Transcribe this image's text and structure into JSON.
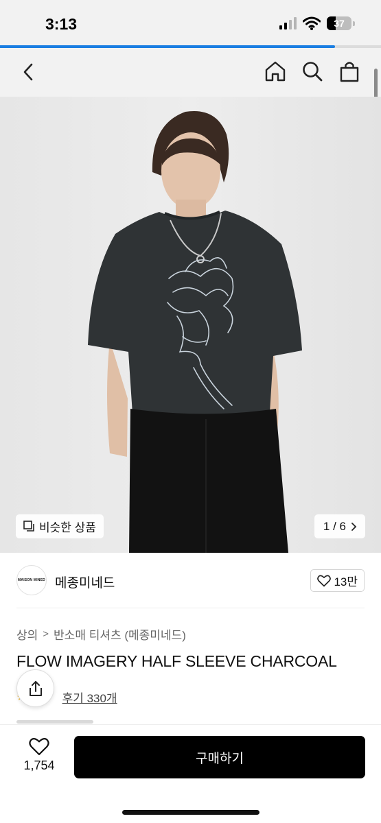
{
  "status_bar": {
    "time": "3:13",
    "battery_level": "37",
    "icons": [
      "signal-icon",
      "wifi-icon",
      "battery-icon"
    ]
  },
  "page_load": {
    "progress": 0.88,
    "color": "#1a7ee2"
  },
  "nav": {
    "back_icon": "chevron-left-icon",
    "right_icons": [
      "home-icon",
      "search-icon",
      "shopping-bag-icon"
    ]
  },
  "gallery": {
    "similar_label": "비슷한 상품",
    "similar_icon": "copy-icon",
    "pager": "1 / 6",
    "pager_icon": "chevron-right-icon"
  },
  "brand": {
    "logo_text": "MAISON MINED",
    "name": "메종미네드",
    "likes": "13만",
    "like_icon": "heart-outline-icon"
  },
  "breadcrumb": {
    "items": [
      "상의",
      "반소매 티셔츠 (메종미네드)"
    ],
    "separator": ">"
  },
  "product": {
    "title": "FLOW IMAGERY HALF SLEEVE CHARCOAL",
    "review_link": "후기 330개",
    "share_icon": "share-icon"
  },
  "bottom_bar": {
    "wish_icon": "heart-outline-icon",
    "wish_count": "1,754",
    "buy_label": "구매하기"
  },
  "colors": {
    "background": "#ffffff",
    "header_bg": "#f2f2f2",
    "buy_button": "#000000",
    "text": "#111111",
    "muted_text": "#666666",
    "tshirt": "#2f3335",
    "trousers": "#121212"
  }
}
